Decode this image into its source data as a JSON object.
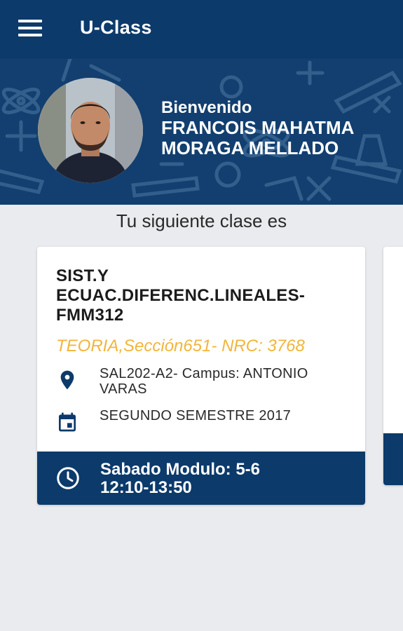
{
  "app": {
    "title": "U-Class"
  },
  "header": {
    "welcome_label": "Bienvenido",
    "user_name": "FRANCOIS MAHATMA MORAGA MELLADO"
  },
  "main": {
    "next_class_label": "Tu siguiente clase es"
  },
  "card": {
    "course_title": "SIST.Y ECUAC.DIFERENC.LINEALES-FMM312",
    "section_info": "TEORIA,Sección651- NRC: 3768",
    "location": "SAL202-A2- Campus: ANTONIO VARAS",
    "term": "SEGUNDO SEMESTRE 2017",
    "schedule_line1": "Sabado Modulo: 5-6",
    "schedule_line2": "12:10-13:50"
  },
  "icons": {
    "menu": "menu-icon",
    "location": "location-pin-icon",
    "calendar": "calendar-icon",
    "clock": "clock-icon"
  },
  "colors": {
    "primary": "#0c3a6b",
    "accent": "#f2b53a",
    "background": "#e9ebee"
  }
}
